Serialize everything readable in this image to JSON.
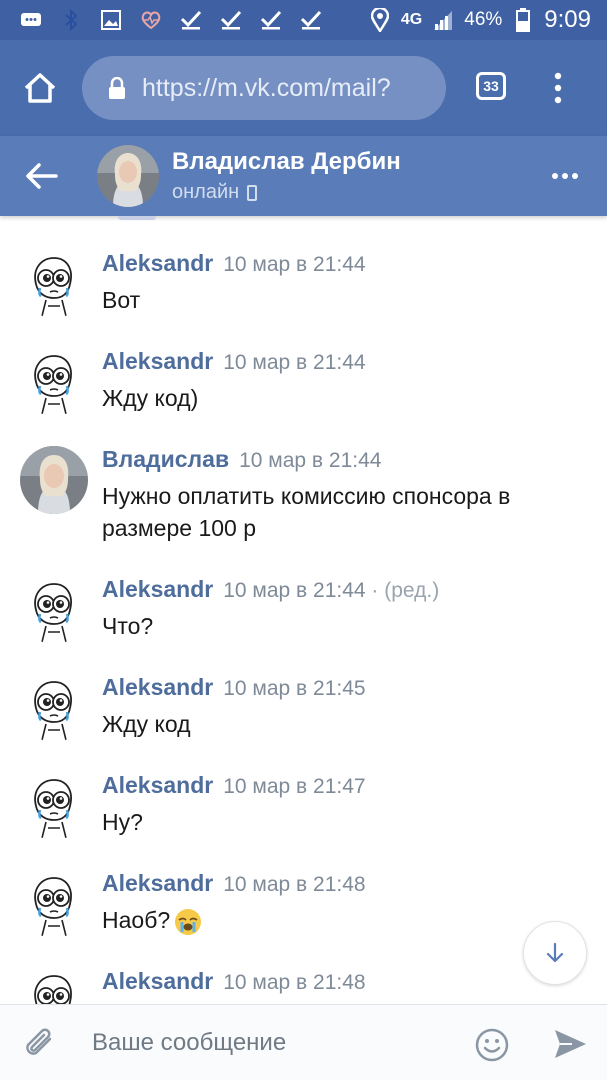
{
  "status_bar": {
    "network": "4G",
    "battery": "46%",
    "time": "9:09",
    "icons": [
      "message-icon",
      "bluetooth-icon",
      "gallery-icon",
      "health-icon",
      "check-icon",
      "check-icon",
      "check-icon",
      "check-icon",
      "location-icon",
      "signal-icon",
      "battery-icon"
    ]
  },
  "browser": {
    "url": "https://m.vk.com/mail?",
    "tab_count": "33"
  },
  "chat_header": {
    "name": "Владислав Дербин",
    "status": "онлайн"
  },
  "messages": [
    {
      "author": "Aleksandr",
      "time": "10 мар в 21:44",
      "edited": "",
      "text": "Вот",
      "avatar": "meme-face"
    },
    {
      "author": "Aleksandr",
      "time": "10 мар в 21:44",
      "edited": "",
      "text": "Жду код)",
      "avatar": "meme-face"
    },
    {
      "author": "Владислав",
      "time": "10 мар в 21:44",
      "edited": "",
      "text": "Нужно оплатить комиссию спонсора в размере 100 р",
      "avatar": "photo"
    },
    {
      "author": "Aleksandr",
      "time": "10 мар в 21:44",
      "edited": " · (ред.)",
      "text": "Что?",
      "avatar": "meme-face"
    },
    {
      "author": "Aleksandr",
      "time": "10 мар в 21:45",
      "edited": "",
      "text": "Жду код",
      "avatar": "meme-face"
    },
    {
      "author": "Aleksandr",
      "time": "10 мар в 21:47",
      "edited": "",
      "text": "Ну?",
      "avatar": "meme-face"
    },
    {
      "author": "Aleksandr",
      "time": "10 мар в 21:48",
      "edited": "",
      "text": "Наоб?",
      "avatar": "meme-face",
      "emoji": "crying-face-emoji"
    },
    {
      "author": "Aleksandr",
      "time": "10 мар в 21:48",
      "edited": "",
      "text": "",
      "avatar": "meme-face"
    }
  ],
  "composer": {
    "placeholder": "Ваше сообщение"
  },
  "colors": {
    "status_bar": "#3f61a3",
    "browser_bar": "#4a6ead",
    "chat_header": "#5a7db9",
    "author_name": "#4f6d9c",
    "timestamp": "#7f8a98"
  }
}
